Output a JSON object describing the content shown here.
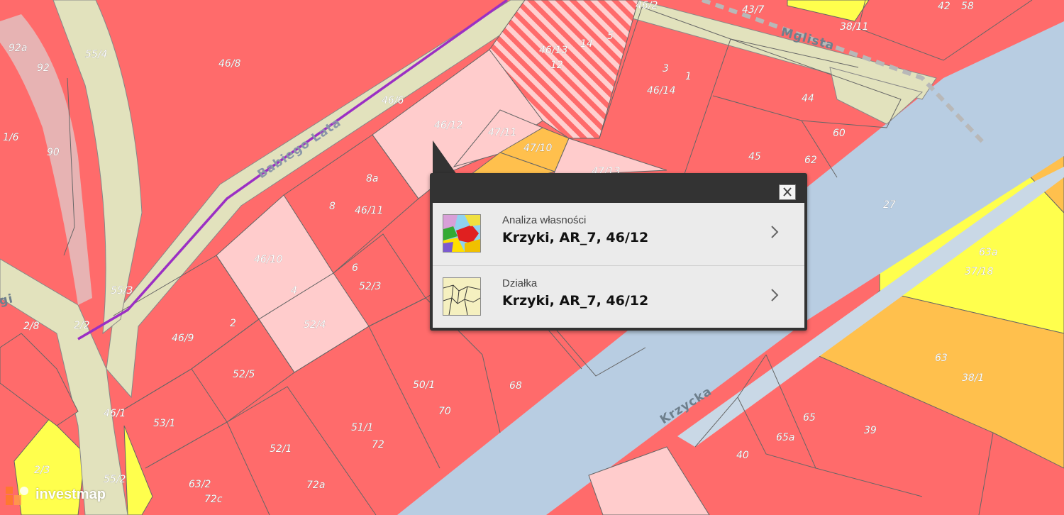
{
  "map": {
    "streets": [
      "Babiego Lata",
      "Mglista",
      "Krzycka",
      "gi"
    ],
    "parcel_labels": [
      "92a",
      "92",
      "1/6",
      "90",
      "55/4",
      "46/8",
      "46/6",
      "46/2",
      "43/7",
      "38/11",
      "42",
      "58",
      "46/13",
      "14",
      "5",
      "12",
      "3",
      "1",
      "46/14",
      "44",
      "60",
      "46/12",
      "47/11",
      "47/10",
      "47/13",
      "45",
      "62",
      "8a",
      "8",
      "46/11",
      "27",
      "63a",
      "37/18",
      "46/10",
      "6",
      "52/3",
      "4",
      "2",
      "46/9",
      "52/4",
      "55/3",
      "2/2",
      "2/8",
      "52/5",
      "50/1",
      "68",
      "70",
      "63",
      "38/1",
      "53/1",
      "46/1",
      "51/1",
      "72",
      "52/1",
      "65",
      "39",
      "65a",
      "40",
      "2/3",
      "63/2",
      "72c",
      "72a",
      "55/2"
    ]
  },
  "popup": {
    "items": [
      {
        "subtitle": "Analiza własności",
        "title": "Krzyki, AR_7, 46/12",
        "icon": "ownership-analysis-icon"
      },
      {
        "subtitle": "Działka",
        "title": "Krzyki, AR_7, 46/12",
        "icon": "parcel-map-icon"
      }
    ]
  },
  "logo": {
    "text": "investmap"
  },
  "colors": {
    "parcel_red": "#ff6b6b",
    "parcel_pink": "#ffcccc",
    "parcel_yellow": "#ffff4d",
    "parcel_orange": "#ffc04d",
    "road_beige": "#e2e2bd",
    "water_blue": "#b8cde2",
    "route_purple": "#9b2fc4",
    "popup_dark": "#333333"
  }
}
